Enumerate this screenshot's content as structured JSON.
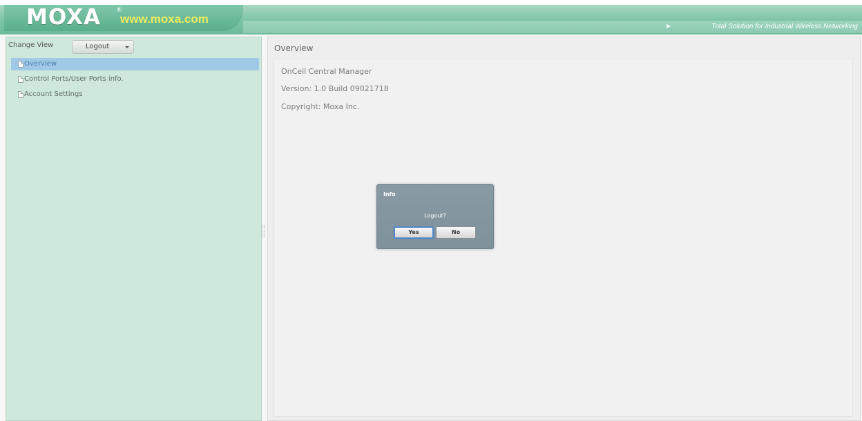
{
  "header": {
    "logo": "MOXA",
    "logo_mark": "®",
    "url": "www.moxa.com",
    "tagline": "Total Solution for Industrial Wireless Networking"
  },
  "sidebar": {
    "change_view_label": "Change View",
    "logout_button_label": "Logout",
    "items": [
      {
        "label": "Overview",
        "selected": true
      },
      {
        "label": "Control Ports/User Ports info.",
        "selected": false
      },
      {
        "label": "Account Settings",
        "selected": false
      }
    ]
  },
  "main": {
    "title": "Overview",
    "lines": [
      "OnCell Central Manager",
      "Version: 1.0 Build 09021718",
      "Copyright: Moxa Inc."
    ]
  },
  "dialog": {
    "title": "Info",
    "message": "Logout?",
    "yes_label": "Yes",
    "no_label": "No"
  },
  "colors": {
    "header_green": "#6cbb9b",
    "logo_url_yellow": "#f0ee5a",
    "sidebar_bg": "#cfe8dc",
    "selection_blue": "#9fc9e6",
    "dialog_bg": "#889aa4"
  },
  "icons": {
    "tree_item_icon": "document-icon",
    "logout_dropdown_icon": "caret-down-icon",
    "tagline_icon": "arrow-right-icon"
  }
}
